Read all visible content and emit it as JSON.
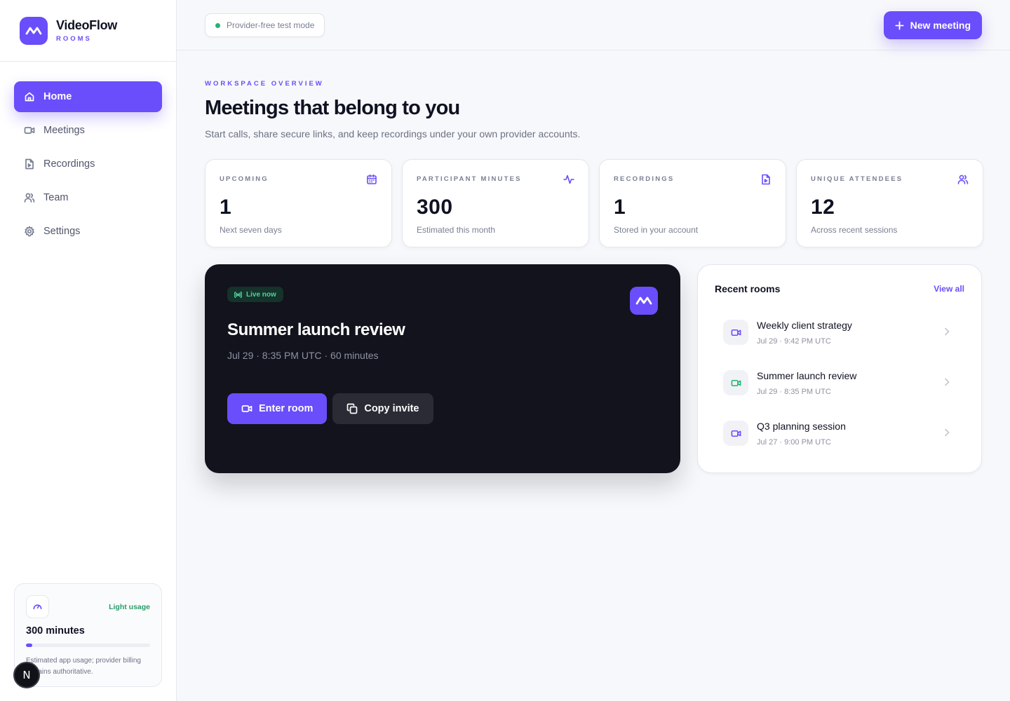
{
  "brand": {
    "name": "VideoFlow",
    "sub": "ROOMS",
    "accent": "#6a4dfb"
  },
  "sidebar": {
    "items": [
      {
        "label": "Home",
        "icon": "home-icon",
        "active": true
      },
      {
        "label": "Meetings",
        "icon": "video-icon",
        "active": false
      },
      {
        "label": "Recordings",
        "icon": "file-icon",
        "active": false
      },
      {
        "label": "Team",
        "icon": "users-icon",
        "active": false
      },
      {
        "label": "Settings",
        "icon": "gear-icon",
        "active": false
      }
    ]
  },
  "usage": {
    "badge": "Light usage",
    "minutes": "300 minutes",
    "fill_fraction": 0.05,
    "note": "Estimated app usage; provider billing remains authoritative."
  },
  "dev_badge": {
    "letter": "N"
  },
  "topbar": {
    "mode_label": "Provider-free test mode",
    "new_meeting_label": "New meeting"
  },
  "header": {
    "eyebrow": "WORKSPACE OVERVIEW",
    "title": "Meetings that belong to you",
    "subtitle": "Start calls, share secure links, and keep recordings under your own provider accounts."
  },
  "stats": [
    {
      "label": "UPCOMING",
      "value": "1",
      "note": "Next seven days",
      "icon": "calendar-icon"
    },
    {
      "label": "PARTICIPANT MINUTES",
      "value": "300",
      "note": "Estimated this month",
      "icon": "activity-icon"
    },
    {
      "label": "RECORDINGS",
      "value": "1",
      "note": "Stored in your account",
      "icon": "file-video-icon"
    },
    {
      "label": "UNIQUE ATTENDEES",
      "value": "12",
      "note": "Across recent sessions",
      "icon": "users-icon"
    }
  ],
  "live": {
    "pill": "Live now",
    "title": "Summer launch review",
    "meta": "Jul 29 · 8:35 PM UTC · 60 minutes",
    "enter_label": "Enter room",
    "copy_label": "Copy invite"
  },
  "recent": {
    "title": "Recent rooms",
    "view_all": "View all",
    "rooms": [
      {
        "name": "Weekly client strategy",
        "time": "Jul 29 · 9:42 PM UTC",
        "icon_color": "#6a4dfb"
      },
      {
        "name": "Summer launch review",
        "time": "Jul 29 · 8:35 PM UTC",
        "icon_color": "#22b573"
      },
      {
        "name": "Q3 planning session",
        "time": "Jul 27 · 9:00 PM UTC",
        "icon_color": "#6a4dfb"
      }
    ]
  }
}
